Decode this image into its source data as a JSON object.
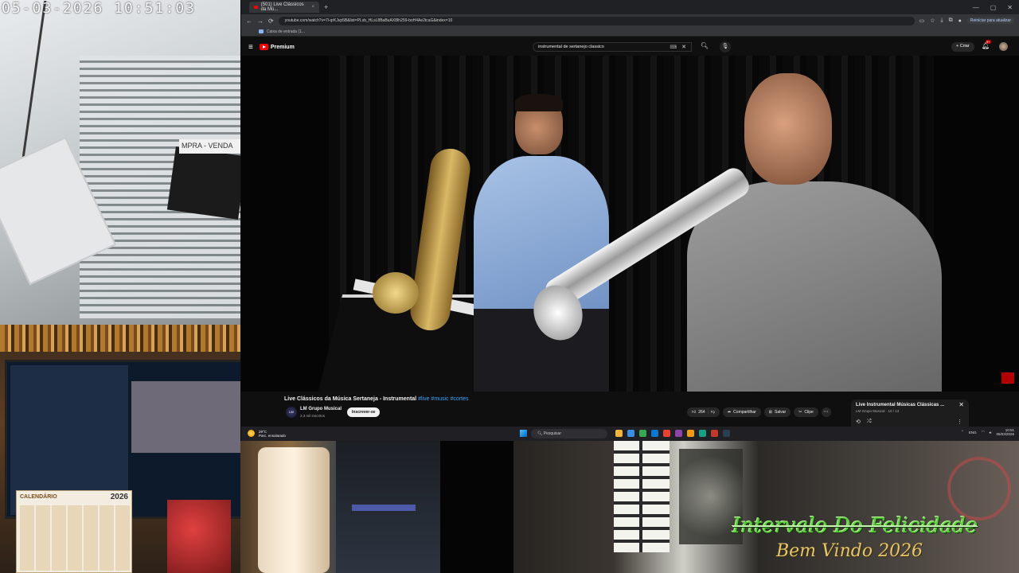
{
  "camera": {
    "timestamp": "05-03-2026 10:51:03",
    "shop_sign": "MPRA - VENDA"
  },
  "webcam": {
    "calendar_title": "CALENDÁRIO",
    "calendar_year": "2026"
  },
  "browser": {
    "tab_title": "(501) Live Clássicos da Mú...",
    "url": "youtube.com/watch?v=7l-qrKJvp5B&list=PLxb_HLsL8BaBuAX8Ih259-boH4Ae2tcaG&index=10",
    "bookmark": "Caixa de entrada (1...",
    "update_label": "Reiniciar para atualizar"
  },
  "youtube": {
    "logo_text": "Premium",
    "search_query": "instrumental de sertanejo classico",
    "create_label": "Criar",
    "notif_count": "9+",
    "video_title": "Live Clássicos da Música Sertaneja - Instrumental",
    "video_tags": "#live #music #cortes",
    "channel_name": "LM Grupo Musical",
    "channel_subs": "2,3 mil inscritos",
    "subscribe_label": "Inscrever-se",
    "like_count": "264",
    "share_label": "Compartilhar",
    "save_label": "Salvar",
    "clip_label": "Clipe",
    "playlist_title": "Live Instrumental Músicas Clássicas ...",
    "playlist_sub": "LM Grupo Musical · 10 / 13"
  },
  "taskbar": {
    "temp": "29°C",
    "weather_desc": "Parc. ensolarado",
    "search_placeholder": "Pesquisar",
    "lang": "ENG",
    "time": "10:51",
    "date": "05/03/2026"
  },
  "overlay": {
    "line1": "Intervalo Do Felicidade",
    "line2": "Bem Vindo 2026"
  },
  "colors": {
    "yt_red": "#ff0000",
    "link_blue": "#3ea6ff",
    "overlay_green": "#5cd23a",
    "overlay_gold": "#e6c66a"
  }
}
